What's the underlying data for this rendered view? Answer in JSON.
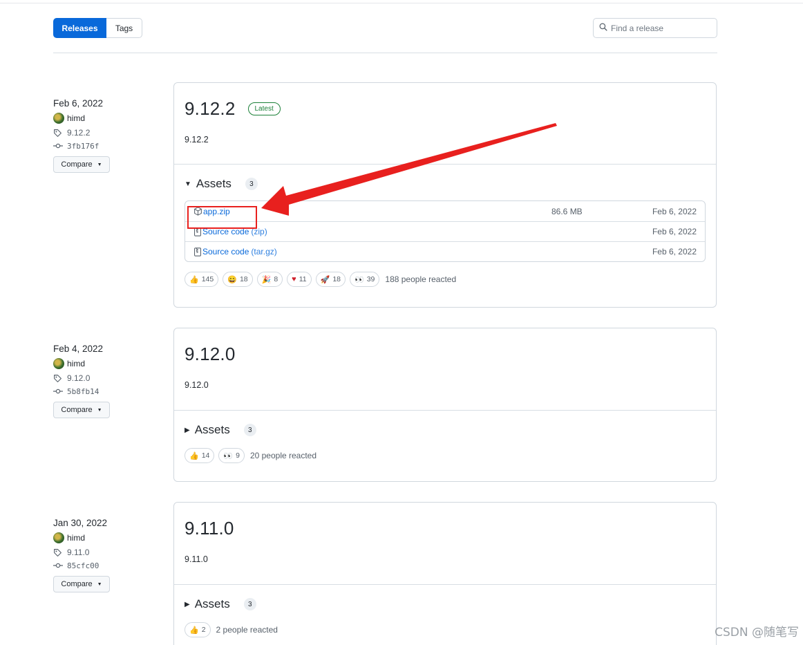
{
  "tabs": {
    "releases": "Releases",
    "tags": "Tags"
  },
  "search": {
    "placeholder": "Find a release"
  },
  "releases": [
    {
      "date": "Feb 6, 2022",
      "author": "himd",
      "tag": "9.12.2",
      "commit": "3fb176f",
      "compare": "Compare",
      "title": "9.12.2",
      "badge": "Latest",
      "description": "9.12.2",
      "assets_label": "Assets",
      "assets_count": "3",
      "assets": [
        {
          "name": "app.zip",
          "ext": "",
          "size": "86.6 MB",
          "date": "Feb 6, 2022",
          "icon": "package-icon"
        },
        {
          "name": "Source code",
          "ext": "(zip)",
          "size": "",
          "date": "Feb 6, 2022",
          "icon": "file-zip-icon"
        },
        {
          "name": "Source code",
          "ext": "(tar.gz)",
          "size": "",
          "date": "Feb 6, 2022",
          "icon": "file-zip-icon"
        }
      ],
      "reactions": [
        {
          "emoji": "thumbs-up",
          "count": "145"
        },
        {
          "emoji": "laugh",
          "count": "18"
        },
        {
          "emoji": "hooray",
          "count": "8"
        },
        {
          "emoji": "heart",
          "count": "11"
        },
        {
          "emoji": "rocket",
          "count": "18"
        },
        {
          "emoji": "eyes",
          "count": "39"
        }
      ],
      "reactions_summary": "188 people reacted"
    },
    {
      "date": "Feb 4, 2022",
      "author": "himd",
      "tag": "9.12.0",
      "commit": "5b8fb14",
      "compare": "Compare",
      "title": "9.12.0",
      "description": "9.12.0",
      "assets_label": "Assets",
      "assets_count": "3",
      "reactions": [
        {
          "emoji": "thumbs-up",
          "count": "14"
        },
        {
          "emoji": "eyes",
          "count": "9"
        }
      ],
      "reactions_summary": "20 people reacted"
    },
    {
      "date": "Jan 30, 2022",
      "author": "himd",
      "tag": "9.11.0",
      "commit": "85cfc00",
      "compare": "Compare",
      "title": "9.11.0",
      "description": "9.11.0",
      "assets_label": "Assets",
      "assets_count": "3",
      "reactions": [
        {
          "emoji": "thumbs-up",
          "count": "2"
        }
      ],
      "reactions_summary": "2 people reacted"
    }
  ],
  "colors": {
    "accent": "#0969da",
    "latest": "#1a7f37",
    "annotation": "#e8201e"
  },
  "watermark": "CSDN @随笔写"
}
